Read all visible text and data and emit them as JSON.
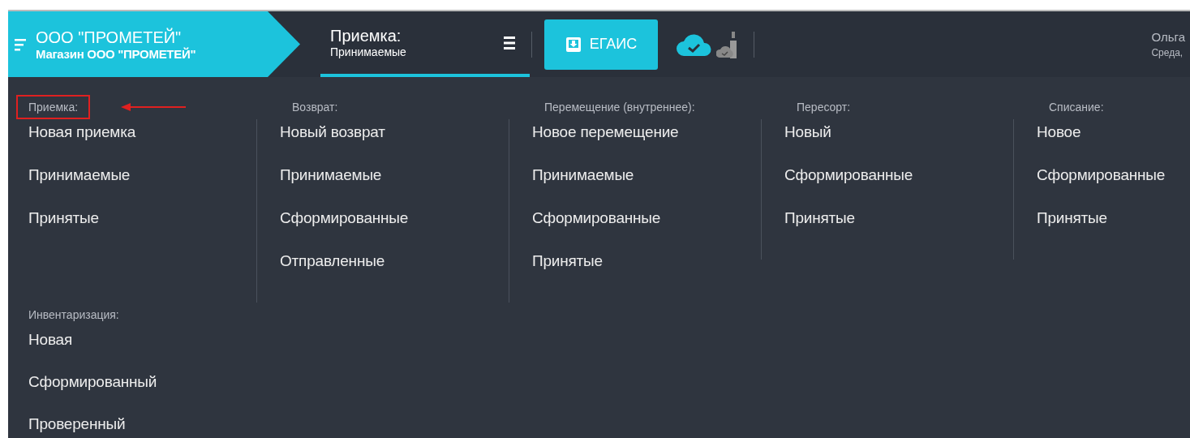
{
  "header": {
    "company": "ООО \"ПРОМЕТЕЙ\"",
    "store": "Магазин ООО \"ПРОМЕТЕЙ\"",
    "page_tab": {
      "title": "Приемка:",
      "subtitle": "Принимаемые",
      "selected": true
    },
    "egais_button": "ЕГАИС",
    "user": {
      "name": "Ольга",
      "date": "Среда,"
    }
  },
  "sections": [
    {
      "title": "Приемка:",
      "highlighted": true,
      "items": [
        "Новая приемка",
        "Принимаемые",
        "Принятые"
      ]
    },
    {
      "title": "Возврат:",
      "highlighted": false,
      "items": [
        "Новый возврат",
        "Принимаемые",
        "Сформированные",
        "Отправленные"
      ]
    },
    {
      "title": "Перемещение (внутреннее):",
      "highlighted": false,
      "items": [
        "Новое перемещение",
        "Принимаемые",
        "Сформированные",
        "Принятые"
      ]
    },
    {
      "title": "Пересорт:",
      "highlighted": false,
      "items": [
        "Новый",
        "Сформированные",
        "Принятые"
      ]
    },
    {
      "title": "Списание:",
      "highlighted": false,
      "items": [
        "Новое",
        "Сформированные",
        "Принятые"
      ]
    }
  ],
  "inventory": {
    "title": "Инвентаризация:",
    "items": [
      "Новая",
      "Сформированный",
      "Проверенный"
    ]
  }
}
